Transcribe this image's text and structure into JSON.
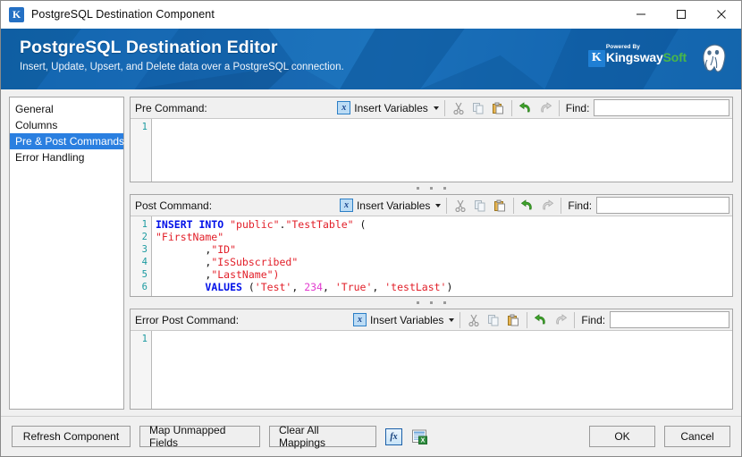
{
  "window": {
    "title": "PostgreSQL Destination Component",
    "app_icon_glyph": "K",
    "controls": {
      "minimize": "minimize-icon",
      "maximize": "maximize-icon",
      "close": "close-icon"
    }
  },
  "header": {
    "title": "PostgreSQL Destination Editor",
    "subtitle": "Insert, Update, Upsert, and Delete data over a PostgreSQL connection.",
    "brand": {
      "powered_by": "Powered By",
      "name_part1": "Kingsway",
      "name_part2": "Soft",
      "k_glyph": "K"
    },
    "colors": {
      "banner_blue": "#1663ad",
      "brand_green": "#49b749",
      "brand_blue": "#1f7fd4"
    }
  },
  "sidebar": {
    "items": [
      {
        "label": "General",
        "selected": false
      },
      {
        "label": "Columns",
        "selected": false
      },
      {
        "label": "Pre & Post Commands",
        "selected": true
      },
      {
        "label": "Error Handling",
        "selected": false
      }
    ],
    "selected_color": "#2a7fe0"
  },
  "toolbar_common": {
    "insert_variables_label": "Insert Variables",
    "insert_variables_icon_glyph": "x",
    "find_label": "Find:",
    "find_value": "",
    "find_placeholder": "",
    "icons": [
      "cut-icon",
      "copy-icon",
      "paste-icon",
      "undo-icon",
      "redo-icon"
    ]
  },
  "panels": [
    {
      "id": "pre",
      "label": "Pre Command:",
      "line_numbers": [
        "1"
      ],
      "lines": []
    },
    {
      "id": "post",
      "label": "Post Command:",
      "line_numbers": [
        "1",
        "2",
        "3",
        "4",
        "5",
        "6"
      ],
      "lines": [
        [
          {
            "t": "INSERT INTO",
            "c": "kw"
          },
          {
            "t": " ",
            "c": "pl"
          },
          {
            "t": "\"public\"",
            "c": "str"
          },
          {
            "t": ".",
            "c": "pl"
          },
          {
            "t": "\"TestTable\"",
            "c": "str"
          },
          {
            "t": " (",
            "c": "pl"
          }
        ],
        [
          {
            "t": "\"FirstName\"",
            "c": "str"
          }
        ],
        [
          {
            "t": "        ,",
            "c": "pl"
          },
          {
            "t": "\"ID\"",
            "c": "str"
          }
        ],
        [
          {
            "t": "        ,",
            "c": "pl"
          },
          {
            "t": "\"IsSubscribed\"",
            "c": "str"
          }
        ],
        [
          {
            "t": "        ,",
            "c": "pl"
          },
          {
            "t": "\"LastName\")",
            "c": "str"
          }
        ],
        [
          {
            "t": "        ",
            "c": "pl"
          },
          {
            "t": "VALUES",
            "c": "kw"
          },
          {
            "t": " (",
            "c": "pl"
          },
          {
            "t": "'Test'",
            "c": "str"
          },
          {
            "t": ", ",
            "c": "pl"
          },
          {
            "t": "234",
            "c": "num"
          },
          {
            "t": ", ",
            "c": "pl"
          },
          {
            "t": "'True'",
            "c": "str"
          },
          {
            "t": ", ",
            "c": "pl"
          },
          {
            "t": "'testLast'",
            "c": "str"
          },
          {
            "t": ")",
            "c": "pl"
          }
        ]
      ]
    },
    {
      "id": "error",
      "label": "Error Post Command:",
      "line_numbers": [
        "1"
      ],
      "lines": []
    }
  ],
  "syntax_colors": {
    "keyword": "#0010e8",
    "string": "#e2202a",
    "number": "#e23ccf",
    "plain": "#111111",
    "line_number": "#1b9aa0"
  },
  "footer": {
    "refresh_component": "Refresh Component",
    "map_unmapped_fields": "Map Unmapped Fields",
    "clear_all_mappings": "Clear All Mappings",
    "fx_glyph": "fx",
    "ok": "OK",
    "cancel": "Cancel"
  }
}
